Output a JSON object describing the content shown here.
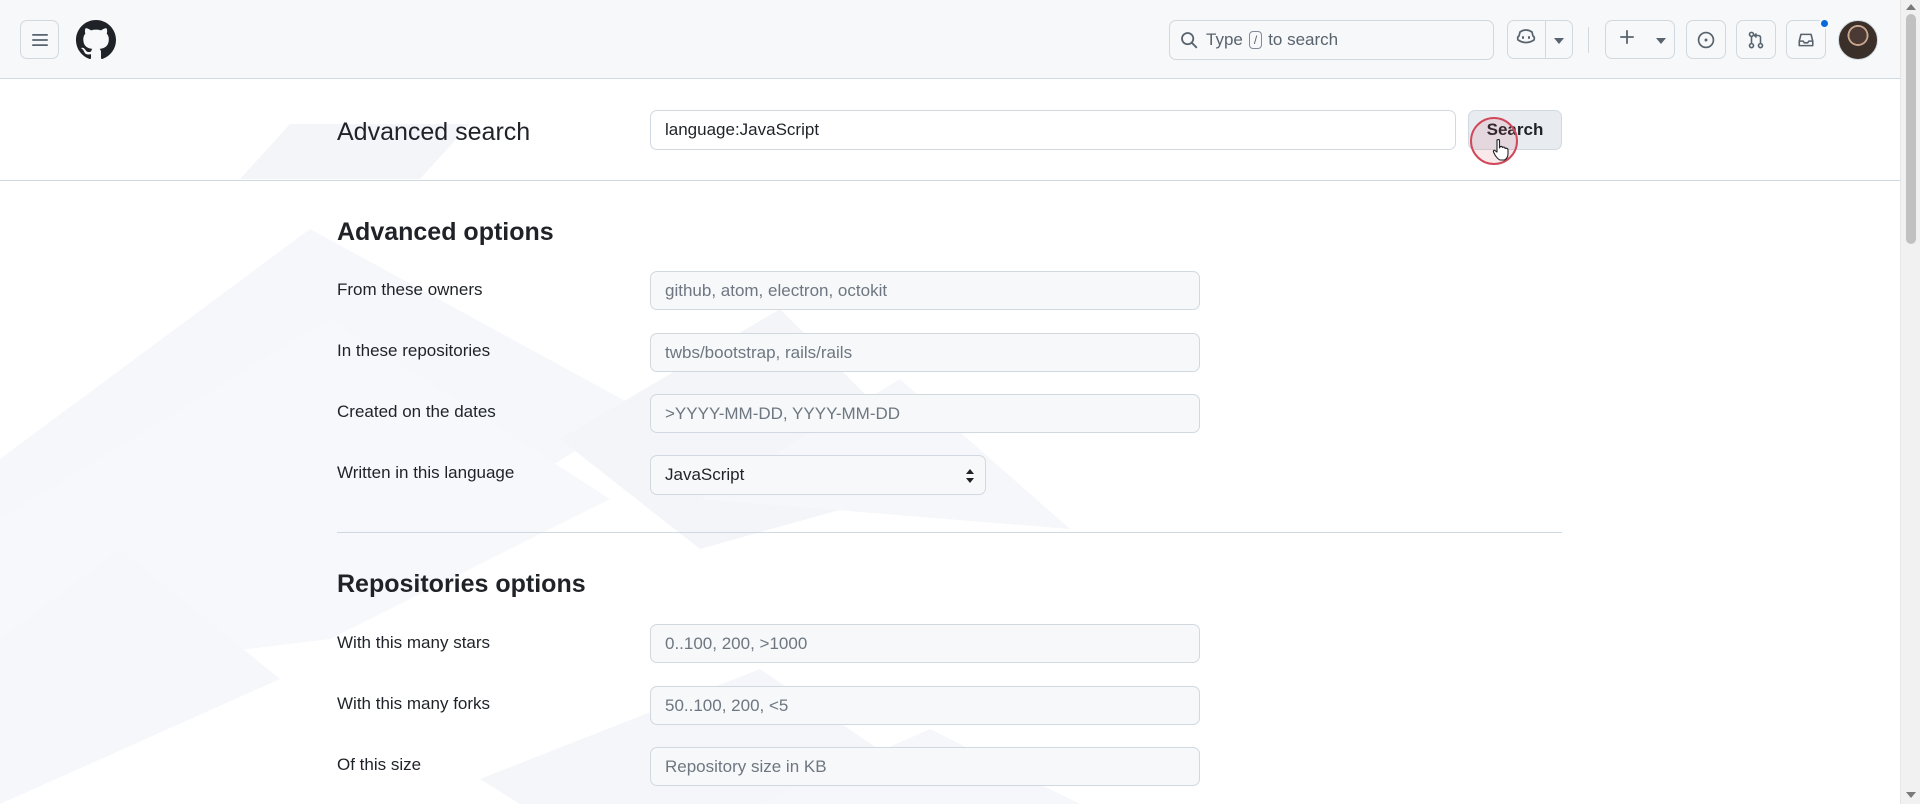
{
  "header": {
    "menu_icon": "hamburger-icon",
    "logo_icon": "github-logo-icon",
    "search_prefix": "Type",
    "search_key": "/",
    "search_suffix": "to search",
    "copilot_icon": "copilot-icon",
    "create_icon": "plus-icon",
    "issues_icon": "issue-opened-icon",
    "pull_requests_icon": "git-pull-request-icon",
    "inbox_icon": "inbox-icon",
    "avatar_icon": "user-avatar"
  },
  "search": {
    "title": "Advanced search",
    "query": "language:JavaScript",
    "button_label": "Search"
  },
  "advanced_options": {
    "title": "Advanced options",
    "fields": [
      {
        "label": "From these owners",
        "placeholder": "github, atom, electron, octokit"
      },
      {
        "label": "In these repositories",
        "placeholder": "twbs/bootstrap, rails/rails"
      },
      {
        "label": "Created on the dates",
        "placeholder": ">YYYY-MM-DD, YYYY-MM-DD"
      }
    ],
    "language": {
      "label": "Written in this language",
      "selected": "JavaScript"
    }
  },
  "repositories_options": {
    "title": "Repositories options",
    "fields": [
      {
        "label": "With this many stars",
        "placeholder": "0..100, 200, >1000"
      },
      {
        "label": "With this many forks",
        "placeholder": "50..100, 200, <5"
      },
      {
        "label": "Of this size",
        "placeholder": "Repository size in KB"
      }
    ]
  },
  "colors": {
    "accent": "#0969da",
    "border": "#d1d9e0",
    "header_bg": "#f6f8fa",
    "text": "#1f2328",
    "muted": "#59636e",
    "click_indicator": "#d0485a"
  }
}
